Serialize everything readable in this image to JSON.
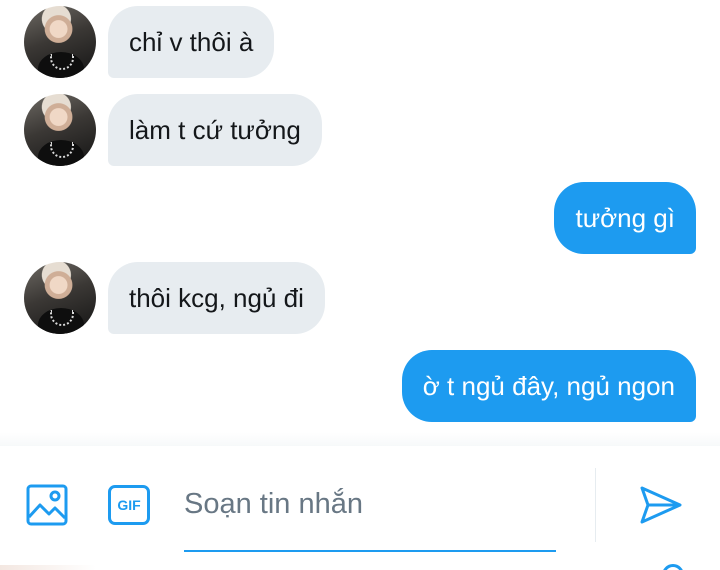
{
  "thread": {
    "messages": [
      {
        "direction": "incoming",
        "text": "chỉ v thôi à"
      },
      {
        "direction": "incoming",
        "text": "làm t cứ tưởng"
      },
      {
        "direction": "outgoing",
        "text": "tưởng gì"
      },
      {
        "direction": "incoming",
        "text": "thôi kcg, ngủ đi"
      },
      {
        "direction": "outgoing",
        "text": "ờ t ngủ đây, ngủ ngon"
      }
    ]
  },
  "composer": {
    "placeholder": "Soạn tin nhắn",
    "value": "",
    "gif_label": "GIF",
    "icons": {
      "image": "image-icon",
      "gif": "gif-icon",
      "send": "send-icon"
    }
  },
  "colors": {
    "accent": "#1d9bf0",
    "incoming_bubble": "#e7ecf0",
    "outgoing_bubble": "#1d9bf0",
    "placeholder": "#687784"
  }
}
